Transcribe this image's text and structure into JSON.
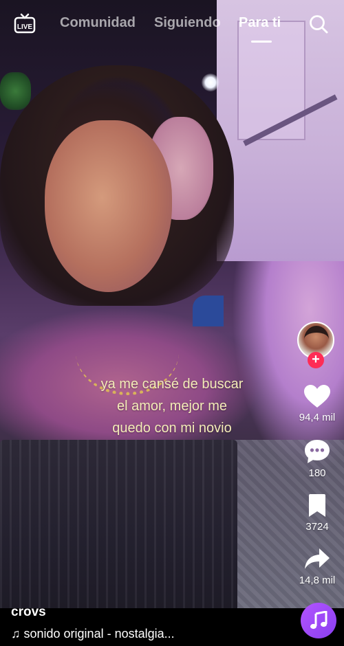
{
  "header": {
    "live_label": "LIVE",
    "tabs": [
      {
        "label": "Comunidad",
        "active": false
      },
      {
        "label": "Siguiendo",
        "active": false
      },
      {
        "label": "Para ti",
        "active": true
      }
    ],
    "search_icon": "search-icon"
  },
  "video": {
    "caption_lines": [
      "ya me cansé de buscar",
      "el amor, mejor me",
      "quedo con mi novio"
    ]
  },
  "side_actions": {
    "follow_symbol": "+",
    "like_count": "94,4 mil",
    "comment_count": "180",
    "save_count": "3724",
    "share_count": "14,8 mil"
  },
  "footer": {
    "username": "crovs",
    "sound": "♫ sonido original - nostalgia..."
  },
  "colors": {
    "accent": "#fe2c55",
    "caption": "#f4ecb8",
    "disc": "#9b45f5"
  }
}
